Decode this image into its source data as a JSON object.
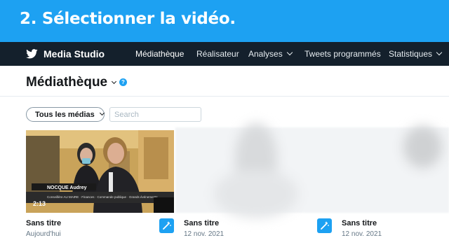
{
  "banner": {
    "text": "2. Sélectionner la vidéo."
  },
  "topnav": {
    "brand": "Media Studio",
    "items": [
      {
        "label": "Médiathèque",
        "active": true,
        "dropdown": false
      },
      {
        "label": "Réalisateur",
        "active": false,
        "dropdown": false
      },
      {
        "label": "Analyses",
        "active": false,
        "dropdown": true
      },
      {
        "label": "Tweets programmés",
        "active": false,
        "dropdown": false
      },
      {
        "label": "Statistiques",
        "active": false,
        "dropdown": true
      }
    ]
  },
  "page": {
    "title": "Médiathèque",
    "help_icon": "question-icon"
  },
  "filter": {
    "label": "Tous les médias"
  },
  "search": {
    "placeholder": "Search",
    "value": ""
  },
  "media": [
    {
      "title": "Sans titre",
      "date": "Aujourd'hui",
      "duration": "2:13",
      "thumbnail": "video-thumbnail"
    },
    {
      "title": "Sans titre",
      "date": "12 nov. 2021"
    },
    {
      "title": "Sans titre",
      "date": "12 nov. 2021"
    }
  ],
  "colors": {
    "banner": "#1da1f2",
    "nav": "#14202c",
    "accent": "#1da1f2"
  }
}
